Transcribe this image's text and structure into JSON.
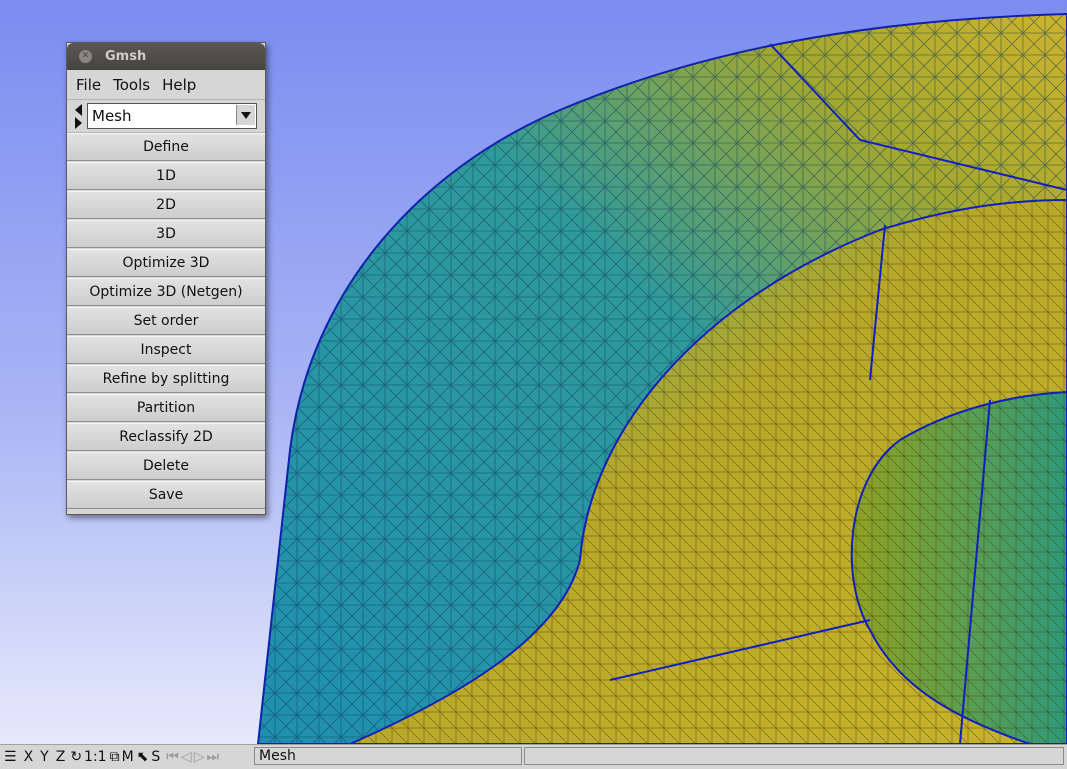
{
  "window": {
    "title": "Gmsh"
  },
  "menu": [
    "File",
    "Tools",
    "Help"
  ],
  "module": {
    "selected": "Mesh"
  },
  "actions": [
    "Define",
    "1D",
    "2D",
    "3D",
    "Optimize 3D",
    "Optimize 3D (Netgen)",
    "Set order",
    "Inspect",
    "Refine by splitting",
    "Partition",
    "Reclassify 2D",
    "Delete",
    "Save"
  ],
  "statusbar": {
    "buttons": [
      "X",
      "Y",
      "Z",
      "1:1",
      "M",
      "S"
    ],
    "message": "Mesh"
  },
  "colors": {
    "background_top": "#7b8cf0",
    "background_bottom": "#e6e9fb",
    "mesh_cool": "#2a8fb0",
    "mesh_warm": "#c8b22a",
    "mesh_edges": "#0a1a9a"
  },
  "icons": [
    "menu-icon",
    "rotate-icon",
    "projection-icon",
    "select-icon",
    "first-icon",
    "previous-icon",
    "next-icon",
    "last-icon",
    "close-icon"
  ]
}
